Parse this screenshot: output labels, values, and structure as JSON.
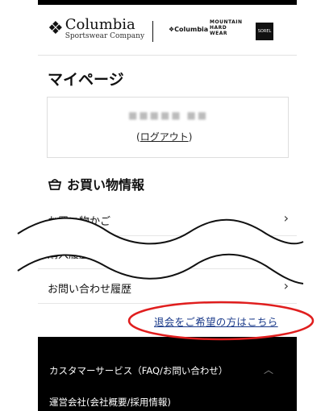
{
  "header": {
    "brand_main_name": "Columbia",
    "brand_main_sub": "Sportswear Company",
    "brand_columbia": "Columbia",
    "brand_mhw": "MOUNTAIN HARD WEAR",
    "brand_sorel": "SOREL"
  },
  "page": {
    "title": "マイページ"
  },
  "user": {
    "name": "■■■■■ ■■",
    "logout_open": "(",
    "logout_label": "ログアウト",
    "logout_close": ")"
  },
  "shopping": {
    "title": "お買い物情報",
    "items": [
      {
        "label": "お買い物かご"
      },
      {
        "label": "購入履歴"
      },
      {
        "label": "お問い合わせ履歴"
      }
    ]
  },
  "withdraw_link": "退会をご希望の方はこちら",
  "footer": {
    "customer_service": "カスタマーサービス（FAQ/お問い合わせ）",
    "company_info": "運営会社(会社概要/採用情報)"
  },
  "colors": {
    "annotation_red": "#e01e1e",
    "link_blue": "#1a3a8a"
  }
}
